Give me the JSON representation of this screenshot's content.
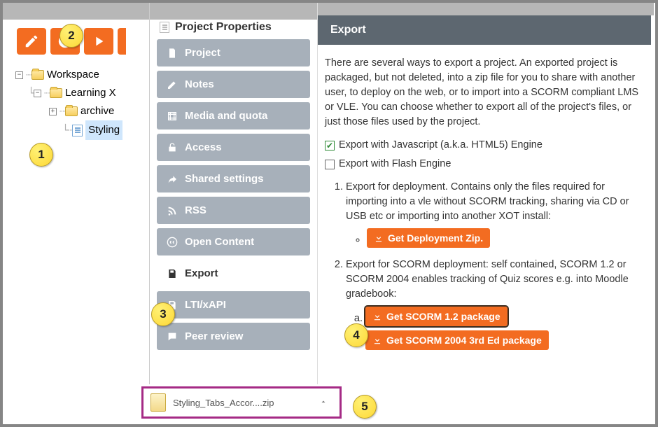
{
  "callouts": {
    "c1": "1",
    "c2": "2",
    "c3": "3",
    "c4": "4",
    "c5": "5"
  },
  "tree": {
    "root": "Workspace",
    "child1": "Learning X",
    "child2": "archive",
    "child3": "Styling"
  },
  "pp_title": "Project Properties",
  "sidebar": {
    "project": "Project",
    "notes": "Notes",
    "media": "Media and quota",
    "access": "Access",
    "shared": "Shared settings",
    "rss": "RSS",
    "open": "Open Content",
    "export": "Export",
    "lti": "LTI/xAPI",
    "peer": "Peer review"
  },
  "export": {
    "title": "Export",
    "intro": "There are several ways to export a project. An exported project is packaged, but not deleted, into a zip file for you to share with another user, to deploy on the web, or to import into a SCORM compliant LMS or VLE. You can choose whether to export all of the project's files, or just those files used by the project.",
    "chk_js": "Export with Javascript (a.k.a. HTML5) Engine",
    "chk_flash": "Export with Flash Engine",
    "item1": "Export for deployment. Contains only the files required for importing into a vle without SCORM tracking, sharing via CD or USB etc or importing into another XOT install:",
    "btn_deploy": "Get Deployment Zip.",
    "item2": "Export for SCORM deployment: self contained, SCORM 1.2 or SCORM 2004 enables tracking of Quiz scores e.g. into Moodle gradebook:",
    "btn_s12": "Get SCORM 1.2 package",
    "btn_s2004": "Get SCORM 2004 3rd Ed package"
  },
  "download": {
    "filename": "Styling_Tabs_Accor....zip"
  }
}
